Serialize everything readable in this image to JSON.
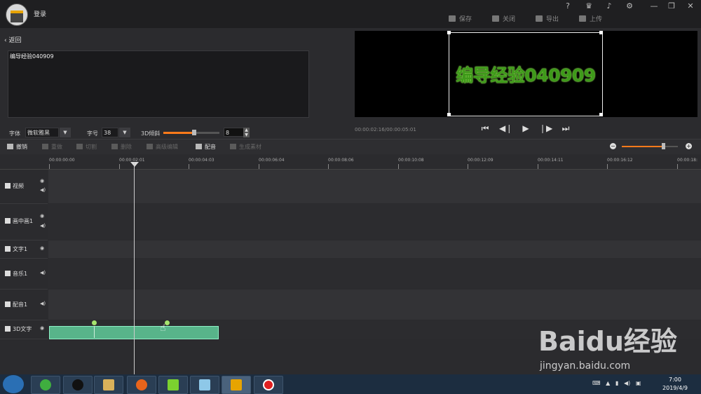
{
  "header": {
    "login_label": "登录",
    "window_icons": [
      "help-icon",
      "vip-icon",
      "bell-icon",
      "gear-icon",
      "minimize-icon",
      "maximize-icon",
      "close-icon"
    ],
    "window_glyphs": [
      "?",
      "♛",
      "♪",
      "⚙",
      "—",
      "❐",
      "✕"
    ],
    "actions": [
      {
        "label": "保存",
        "icon": "save-icon"
      },
      {
        "label": "关闭",
        "icon": "exit-icon"
      },
      {
        "label": "导出",
        "icon": "export-icon"
      },
      {
        "label": "上传",
        "icon": "upload-icon"
      }
    ]
  },
  "editor": {
    "back_label": "返回",
    "text_value": "编导经验040909",
    "font_label": "字体",
    "font_value": "微软雅黑",
    "size_label": "字号",
    "size_value": "38",
    "tilt_label": "3D倾斜",
    "tilt_value": "8",
    "tilt_level_fraction": 0.55
  },
  "preview": {
    "text": "编导经验040909",
    "timecode": "00:00:02:16/00:00:05:01",
    "text_color": "#3e9a1a"
  },
  "toolbar": {
    "items": [
      {
        "label": "撤销",
        "icon": "undo-icon",
        "enabled": true
      },
      {
        "label": "重做",
        "icon": "redo-icon",
        "enabled": false
      },
      {
        "label": "切割",
        "icon": "cut-icon",
        "enabled": false
      },
      {
        "label": "删除",
        "icon": "delete-icon",
        "enabled": false
      },
      {
        "label": "高级编辑",
        "icon": "edit-icon",
        "enabled": false
      },
      {
        "label": "配音",
        "icon": "mic-icon",
        "enabled": true
      },
      {
        "label": "生成素材",
        "icon": "material-icon",
        "enabled": false
      }
    ],
    "zoom_level_fraction": 0.74
  },
  "ruler": {
    "ticks": [
      "00:00:00:00",
      "00:00:02:01",
      "00:00:04:03",
      "00:00:06:04",
      "00:00:08:06",
      "00:00:10:08",
      "00:00:12:09",
      "00:00:14:11",
      "00:00:16:12",
      "00:00:18:"
    ]
  },
  "tracks": [
    {
      "name": "视频",
      "icon": "video-icon",
      "eye": true,
      "speaker": true
    },
    {
      "name": "画中画1",
      "icon": "pip-icon",
      "eye": true,
      "speaker": true
    },
    {
      "name": "文字1",
      "icon": "text-icon",
      "eye": true,
      "speaker": false
    },
    {
      "name": "音乐1",
      "icon": "music-icon",
      "eye": false,
      "speaker": true
    },
    {
      "name": "配音1",
      "icon": "mic-icon",
      "eye": false,
      "speaker": true
    },
    {
      "name": "3D文字",
      "icon": "text-icon",
      "eye": true,
      "speaker": false
    }
  ],
  "taskbar": {
    "time": "7:00",
    "date": "2019/4/9",
    "apps": [
      "browser-icon",
      "qq-icon",
      "explorer-icon",
      "firefox-icon",
      "media-icon",
      "app-icon",
      "editor-icon",
      "record-icon"
    ]
  },
  "watermark": {
    "brand": "Baidu经验",
    "url": "jingyan.baidu.com"
  },
  "colors": {
    "accent": "#ff7a1a",
    "clip": "#58b48a",
    "background": "#2b2b2e"
  }
}
